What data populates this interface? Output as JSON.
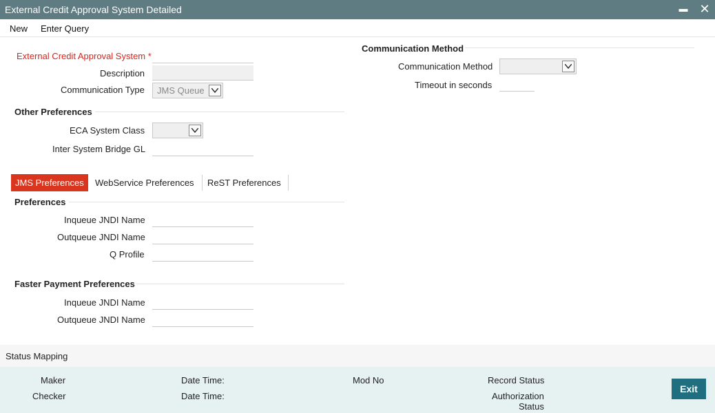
{
  "window": {
    "title": "External Credit Approval System Detailed",
    "minimize_glyph": "▬",
    "close_glyph": "✕"
  },
  "menu": {
    "new_label": "New",
    "enter_query_label": "Enter Query"
  },
  "main": {
    "eca_system_label": "External Credit Approval System",
    "required_marker": "*",
    "description_label": "Description",
    "comm_type_label": "Communication Type",
    "comm_type_value": "JMS Queue",
    "other_prefs_title": "Other Preferences",
    "eca_system_class_label": "ECA System Class",
    "inter_system_bridge_label": "Inter System Bridge GL"
  },
  "comm": {
    "section_title": "Communication Method",
    "method_label": "Communication Method",
    "timeout_label": "Timeout in seconds"
  },
  "tabs": [
    {
      "label": "JMS Preferences",
      "active": true
    },
    {
      "label": "WebService Preferences",
      "active": false
    },
    {
      "label": "ReST Preferences",
      "active": false
    }
  ],
  "jms": {
    "prefs_title": "Preferences",
    "inqueue_label": "Inqueue JNDI Name",
    "outqueue_label": "Outqueue JNDI Name",
    "qprofile_label": "Q Profile",
    "faster_title": "Faster Payment Preferences",
    "fp_inqueue_label": "Inqueue JNDI Name",
    "fp_outqueue_label": "Outqueue JNDI Name"
  },
  "status_mapping_label": "Status Mapping",
  "footer": {
    "maker_label": "Maker",
    "checker_label": "Checker",
    "datetime1_label": "Date Time:",
    "datetime2_label": "Date Time:",
    "mod_no_label": "Mod No",
    "record_status_label": "Record Status",
    "auth_status_line1": "Authorization",
    "auth_status_line2": "Status",
    "exit_label": "Exit"
  },
  "colors": {
    "titlebar": "#5f7c83",
    "accent_red": "#d9351f",
    "footer_bg": "#e6f1f1",
    "exit_button": "#1f6f80"
  }
}
